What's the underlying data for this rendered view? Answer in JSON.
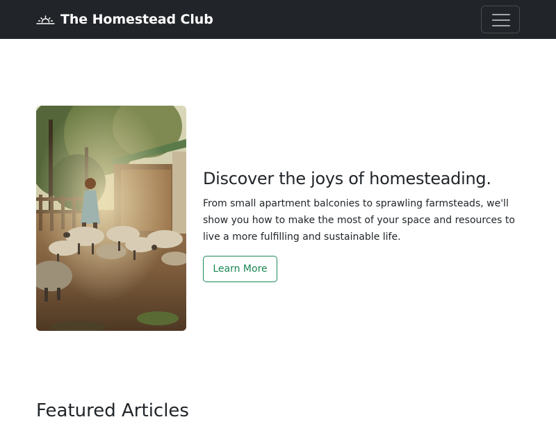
{
  "navbar": {
    "brand_text": "The Homestead Club",
    "brand_icon": "sunrise-icon",
    "toggler_icon": "hamburger-menu-icon",
    "background_color": "#212529"
  },
  "hero": {
    "image_subject": "woman-with-sheep-photo",
    "title": "Discover the joys of homesteading.",
    "description": "From small apartment balconies to sprawling farmsteads, we'll show you how to make the most of your space and resources to live a more fulfilling and sustainable life.",
    "button_label": "Learn More",
    "accent_color": "#198754"
  },
  "featured": {
    "title": "Featured Articles"
  }
}
